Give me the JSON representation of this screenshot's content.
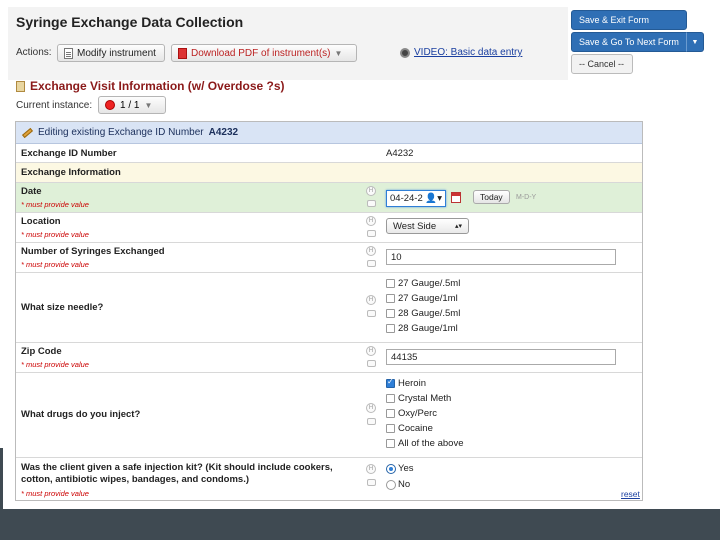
{
  "page": {
    "title": "Syringe Exchange Data Collection"
  },
  "actions": {
    "label": "Actions:",
    "modify": "Modify instrument",
    "download_pdf": "Download PDF of instrument(s)",
    "video": "VIDEO: Basic data entry"
  },
  "section": {
    "title": "Exchange Visit Information (w/ Overdose ?s)"
  },
  "instance": {
    "label": "Current instance:",
    "value": "1 / 1"
  },
  "right_buttons": {
    "save_exit": "Save & Exit Form",
    "save_next": "Save & Go To Next Form",
    "cancel": "-- Cancel --"
  },
  "form": {
    "editing_text": "Editing existing Exchange ID Number ",
    "editing_id": "A4232",
    "required_note": "* must provide value",
    "fields": {
      "exchange_id": {
        "label": "Exchange ID Number",
        "value": "A4232"
      },
      "exchange_info": {
        "label": "Exchange Information"
      },
      "date": {
        "label": "Date",
        "value": "04-24-2",
        "today": "Today",
        "format": "M-D-Y"
      },
      "location": {
        "label": "Location",
        "value": "West Side"
      },
      "syringes": {
        "label": "Number of Syringes Exchanged",
        "value": "10"
      },
      "needle": {
        "label": "What size needle?",
        "options": [
          "27 Gauge/.5ml",
          "27 Gauge/1ml",
          "28 Gauge/.5ml",
          "28 Gauge/1ml"
        ],
        "checked": [
          false,
          false,
          false,
          false
        ]
      },
      "zip": {
        "label": "Zip Code",
        "value": "44135"
      },
      "drugs": {
        "label": "What drugs do you inject?",
        "options": [
          "Heroin",
          "Crystal Meth",
          "Oxy/Perc",
          "Cocaine",
          "All of the above"
        ],
        "checked": [
          true,
          false,
          false,
          false,
          false
        ]
      },
      "kit": {
        "label": "Was the client given a safe injection kit? (Kit should include cookers, cotton, antibiotic wipes, bandages, and condoms.)",
        "options": [
          "Yes",
          "No"
        ],
        "selected": "Yes",
        "reset": "reset"
      }
    }
  },
  "colors": {
    "accent_blue": "#2f6fb5",
    "required_red": "#cc0000",
    "section_red": "#8b1a1a",
    "date_row_bg": "#dff0d8",
    "info_row_bg": "#fcf8e3",
    "edit_bar_bg": "#d9e4f5"
  }
}
